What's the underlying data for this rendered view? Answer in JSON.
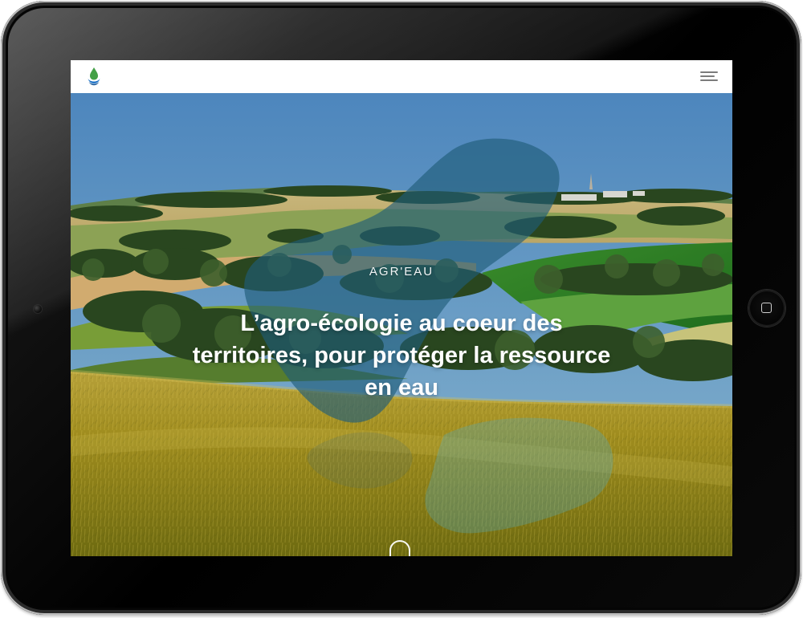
{
  "site": {
    "logo_icon": "water-drop-logo-icon",
    "menu_icon": "hamburger-menu-icon"
  },
  "hero": {
    "kicker": "AGR'EAU",
    "title": "L’agro-écologie au coeur des territoires, pour protéger la ressource en eau",
    "scroll_icon": "scroll-down-icon"
  },
  "device": {
    "home_icon": "home-button-icon"
  },
  "colors": {
    "overlay_teal": "#1f5c78",
    "logo_green": "#43a047",
    "logo_blue": "#1f73c7"
  }
}
